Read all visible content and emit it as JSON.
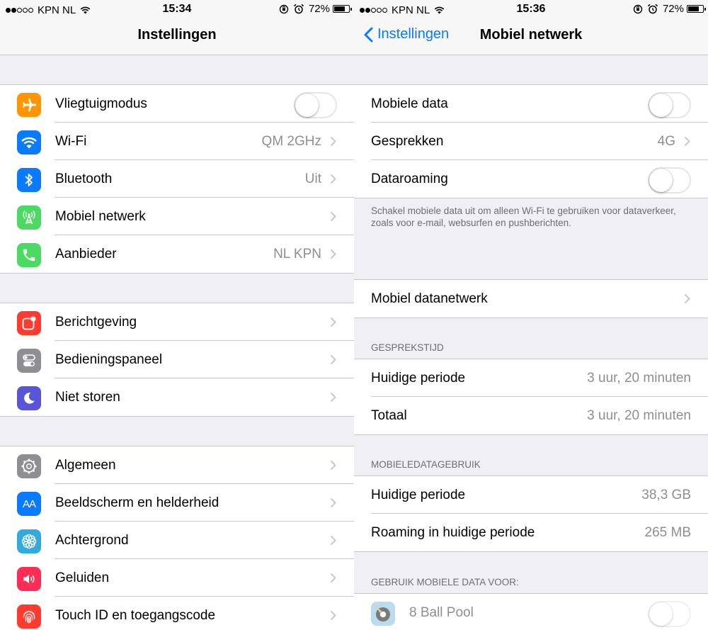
{
  "left": {
    "status": {
      "carrier": "KPN NL",
      "time": "15:34",
      "battery": "72%"
    },
    "title": "Instellingen",
    "groups": [
      [
        {
          "label": "Vliegtuigmodus",
          "icon": "airplane-icon",
          "color": "#ff9500"
        },
        {
          "label": "Wi-Fi",
          "value": "QM 2GHz",
          "icon": "wifi-icon",
          "color": "#0a7aff"
        },
        {
          "label": "Bluetooth",
          "value": "Uit",
          "icon": "bluetooth-icon",
          "color": "#0a7aff"
        },
        {
          "label": "Mobiel netwerk",
          "value": "",
          "icon": "cellular-icon",
          "color": "#4cd964"
        },
        {
          "label": "Aanbieder",
          "value": "NL KPN",
          "icon": "phone-icon",
          "color": "#4cd964"
        }
      ],
      [
        {
          "label": "Berichtgeving",
          "icon": "notifications-icon",
          "color": "#ff3b30"
        },
        {
          "label": "Bedieningspaneel",
          "icon": "control-center-icon",
          "color": "#8e8e93"
        },
        {
          "label": "Niet storen",
          "icon": "moon-icon",
          "color": "#5856d6"
        }
      ],
      [
        {
          "label": "Algemeen",
          "icon": "gear-icon",
          "color": "#8e8e93"
        },
        {
          "label": "Beeldscherm en helderheid",
          "icon": "display-icon",
          "icon_text": "AA",
          "color": "#0a7aff"
        },
        {
          "label": "Achtergrond",
          "icon": "wallpaper-icon",
          "color": "#34aadc"
        },
        {
          "label": "Geluiden",
          "icon": "sound-icon",
          "color": "#ff2d55"
        },
        {
          "label": "Touch ID en toegangscode",
          "icon": "fingerprint-icon",
          "color": "#ff3b30"
        }
      ]
    ]
  },
  "right": {
    "status": {
      "carrier": "KPN NL",
      "time": "15:36",
      "battery": "72%"
    },
    "back_label": "Instellingen",
    "title": "Mobiel netwerk",
    "group1": [
      {
        "label": "Mobiele data"
      },
      {
        "label": "Gesprekken",
        "value": "4G"
      },
      {
        "label": "Dataroaming"
      }
    ],
    "footer": "Schakel mobiele data uit om alleen Wi-Fi te gebruiken voor dataverkeer, zoals voor e-mail, websurfen en pushberichten.",
    "mobile_datanetwork": "Mobiel datanetwerk",
    "call_time_header": "GESPREKSTIJD",
    "call_time": [
      {
        "label": "Huidige periode",
        "value": "3 uur, 20 minuten"
      },
      {
        "label": "Totaal",
        "value": "3 uur, 20 minuten"
      }
    ],
    "data_usage_header": "MOBIELEDATAGEBRUIK",
    "data_usage": [
      {
        "label": "Huidige periode",
        "value": "38,3 GB"
      },
      {
        "label": "Roaming in huidige periode",
        "value": "265 MB"
      }
    ],
    "use_for_header": "GEBRUIK MOBIELE DATA VOOR:",
    "app": {
      "label": "8 Ball Pool",
      "icon": "8-ball-pool-icon"
    }
  },
  "colors": {
    "accent": "#0a7aff",
    "separator": "#c8c7cc",
    "background": "#efeff4",
    "secondary_text": "#8e8e93"
  }
}
